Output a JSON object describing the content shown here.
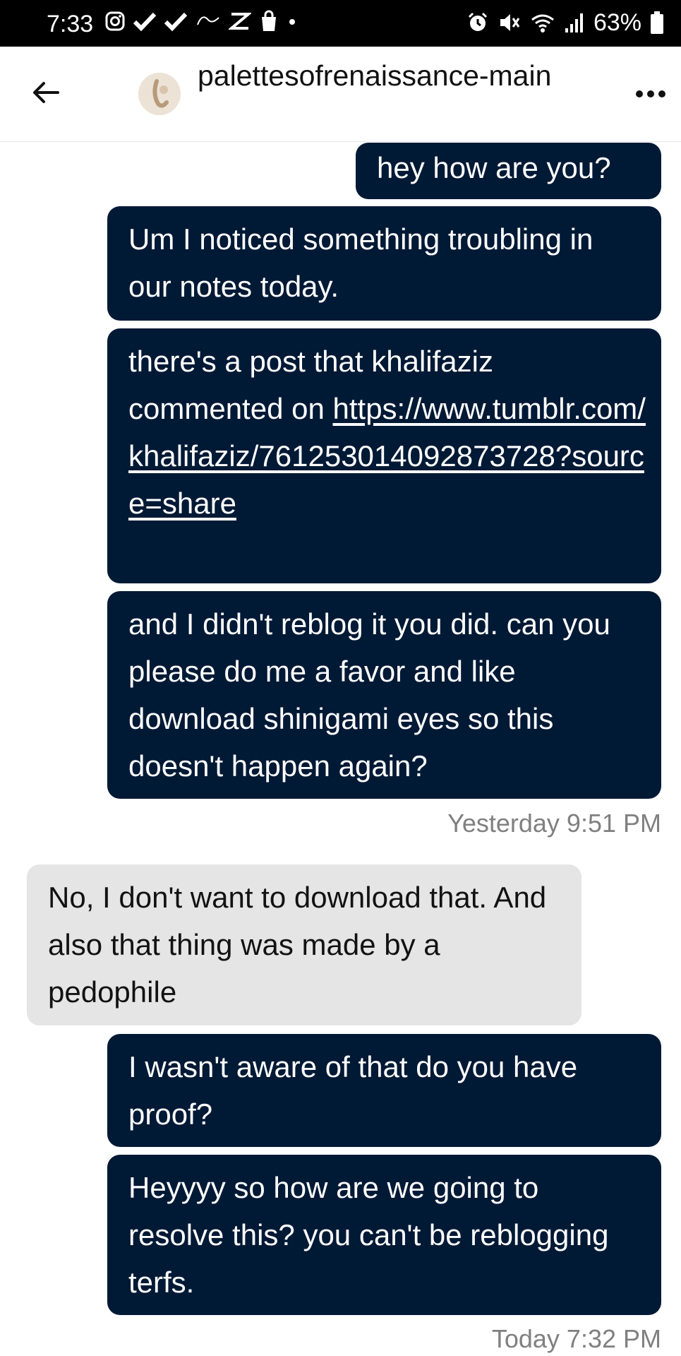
{
  "status_bar": {
    "time": "7:33",
    "battery_percent": "63%"
  },
  "header": {
    "blog_name": "palettesofrenaissance-main"
  },
  "messages": [
    {
      "from": "me",
      "text": "hey how are you?"
    },
    {
      "from": "me",
      "text": "Um I noticed something troubling in our notes today."
    },
    {
      "from": "me",
      "text": "there's a post that khalifaziz commented on ",
      "link": "https://www.tumblr.com/khalifaziz/761253014092873728?source=share"
    },
    {
      "from": "me",
      "text": "and I didn't reblog it you did. can you please do me a favor and like download shinigami eyes so this doesn't happen again?"
    },
    {
      "from": "them",
      "text": "No, I don't want to download that. And also that thing was made by a pedophile"
    },
    {
      "from": "me",
      "text": "I wasn't aware of that do you have proof?"
    },
    {
      "from": "me",
      "text": "Heyyyy so how are we going to resolve this? you can't be reblogging terfs."
    }
  ],
  "timestamps": {
    "first": "Yesterday 9:51 PM",
    "second": "Today 7:32 PM"
  },
  "colors": {
    "outgoing_bubble": "#001935",
    "incoming_bubble": "#e5e5e5",
    "status_bar": "#000000"
  }
}
